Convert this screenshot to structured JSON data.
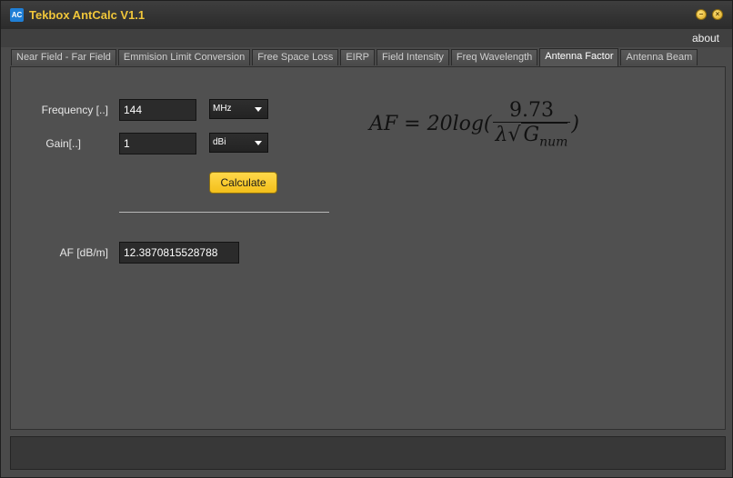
{
  "window": {
    "title": "Tekbox AntCalc V1.1",
    "icon_text": "AC"
  },
  "menu": {
    "about": "about"
  },
  "tabs": [
    {
      "label": "Near Field - Far Field"
    },
    {
      "label": "Emmision Limit Conversion"
    },
    {
      "label": "Free Space Loss"
    },
    {
      "label": "EIRP"
    },
    {
      "label": "Field Intensity"
    },
    {
      "label": "Freq Wavelength"
    },
    {
      "label": "Antenna Factor"
    },
    {
      "label": "Antenna Beam"
    }
  ],
  "active_tab": "Antenna Factor",
  "form": {
    "frequency_label": "Frequency [..]",
    "frequency_value": "144",
    "frequency_unit": "MHz",
    "gain_label": "Gain[..]",
    "gain_value": "1",
    "gain_unit": "dBi",
    "calculate_label": "Calculate",
    "result_label": "AF [dB/m]",
    "result_value": "12.3870815528788"
  },
  "formula": {
    "lhs": "AF = 20log(",
    "numerator": "9.73",
    "den_lambda": "λ",
    "den_sqrt_symbol": "√",
    "den_var": "G",
    "den_sub": "num",
    "rhs": ")"
  },
  "colors": {
    "title_text": "#f0c63a",
    "accent_button": "#f3bf1a",
    "panel_bg": "#505050"
  }
}
